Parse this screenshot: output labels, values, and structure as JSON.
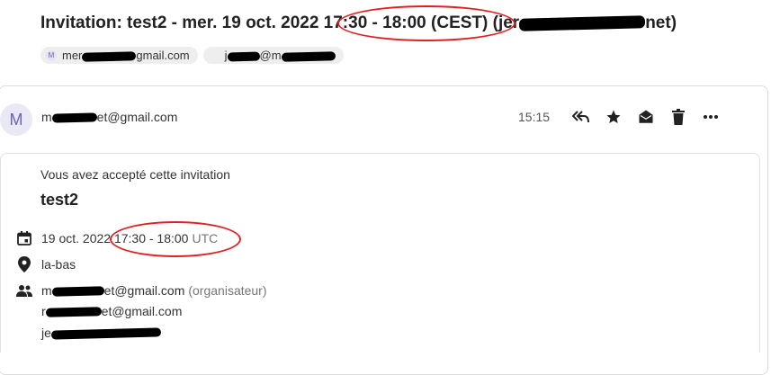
{
  "email": {
    "subject": "Invitation: test2 - mer. 19 oct. 2022 17:30 - 18:00 (CEST) (jer",
    "subject_tail": "net)",
    "recipients": [
      {
        "avatar_letter": "M",
        "start": "mer",
        "end": "gmail.com"
      },
      {
        "avatar_letter": "",
        "start": "j",
        "end": "@m"
      }
    ]
  },
  "message": {
    "avatar_letter": "M",
    "sender_start": "m",
    "sender_end": "et@gmail.com",
    "time": "15:15"
  },
  "actions": [
    {
      "icon": "reply-all-icon"
    },
    {
      "icon": "star-icon"
    },
    {
      "icon": "envelope-open-icon"
    },
    {
      "icon": "trash-icon"
    },
    {
      "icon": "more-icon"
    }
  ],
  "invitation": {
    "status": "Vous avez accepté cette invitation",
    "title": "test2",
    "date": "19 oct. 2022",
    "time_range": "17:30 - 18:00",
    "timezone": "UTC",
    "location": "la-bas",
    "attendees": [
      {
        "start": "m",
        "end": "et@gmail.com",
        "role": "(organisateur)"
      },
      {
        "start": "r",
        "end": "et@gmail.com",
        "role": ""
      },
      {
        "start": "je",
        "end": "",
        "role": ""
      }
    ]
  },
  "colors": {
    "annotation": "#e02020",
    "avatar_text": "#6a63b3",
    "avatar_bg": "#e9e9f5"
  }
}
